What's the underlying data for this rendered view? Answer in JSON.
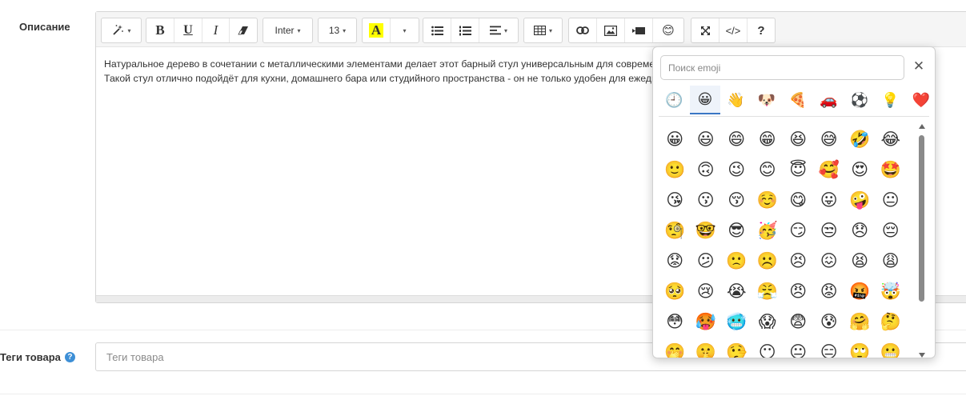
{
  "description_field": {
    "label": "Описание",
    "text_lines": [
      "Натуральное дерево в сочетании с металлическими элементами делает этот барный стул универсальным для современных и классических интерьеров. Удобная",
      "Такой стул отлично подойдёт для кухни, домашнего бара или студийного пространства - он не только удобен для ежедневного использования, но и благодаря своей форме"
    ]
  },
  "toolbar": {
    "magic_caret": "▾",
    "bold": "B",
    "underline": "U",
    "italic": "I",
    "eraser": "⌫",
    "font_name": "Inter",
    "font_size": "13",
    "text_color": "A",
    "color_caret": "▾",
    "code_view": "</>",
    "help": "?"
  },
  "tags_field": {
    "label": "Теги товара",
    "help": "?",
    "placeholder": "Теги товара"
  },
  "emoji_picker": {
    "search_placeholder": "Поиск emoji",
    "close": "✕",
    "categories": [
      {
        "name": "recent",
        "glyph": "🕘"
      },
      {
        "name": "smileys",
        "glyph": "😀"
      },
      {
        "name": "people",
        "glyph": "👋"
      },
      {
        "name": "animals",
        "glyph": "🐶"
      },
      {
        "name": "food",
        "glyph": "🍕"
      },
      {
        "name": "travel",
        "glyph": "🚗"
      },
      {
        "name": "activities",
        "glyph": "⚽"
      },
      {
        "name": "objects",
        "glyph": "💡"
      },
      {
        "name": "symbols",
        "glyph": "❤️"
      }
    ],
    "active_category": "smileys",
    "emojis": [
      "😀",
      "😃",
      "😄",
      "😁",
      "😆",
      "😅",
      "🤣",
      "😂",
      "🙂",
      "🙃",
      "😉",
      "😊",
      "😇",
      "🥰",
      "😍",
      "🤩",
      "😘",
      "😗",
      "😚",
      "☺️",
      "😋",
      "😛",
      "🤪",
      "😐",
      "🧐",
      "🤓",
      "😎",
      "🥳",
      "😏",
      "😒",
      "😞",
      "😔",
      "😟",
      "😕",
      "🙁",
      "☹️",
      "😣",
      "😖",
      "😫",
      "😩",
      "🥺",
      "😢",
      "😭",
      "😤",
      "😠",
      "😡",
      "🤬",
      "🤯",
      "😳",
      "🥵",
      "🥶",
      "😱",
      "😨",
      "😰",
      "🤗",
      "🤔",
      "🤭",
      "🤫",
      "🤥",
      "😶",
      "😐",
      "😑",
      "🙄",
      "😬"
    ]
  },
  "colors": {
    "accent": "#3a76c4",
    "help_badge": "#3d8fd6",
    "highlight_yellow": "#ffff00"
  }
}
